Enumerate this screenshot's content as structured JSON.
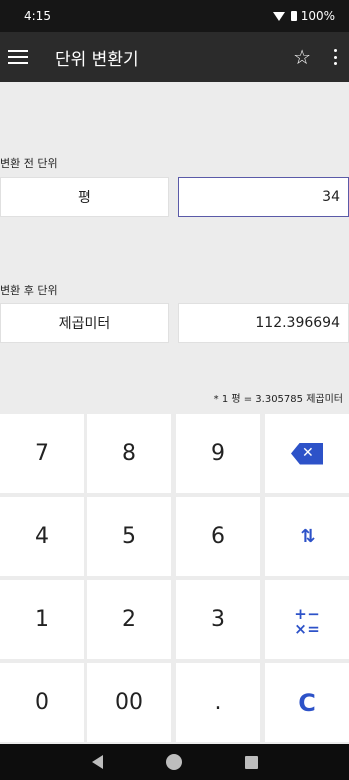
{
  "status_bar": {
    "time": "4:15",
    "battery": "100%"
  },
  "app_bar": {
    "title": "단위 변환기"
  },
  "from": {
    "label": "변환 전 단위",
    "unit": "평",
    "value": "34"
  },
  "to": {
    "label": "변환 후 단위",
    "unit": "제곱미터",
    "value": "112.396694"
  },
  "note": "* 1 평 = 3.305785 제곱미터",
  "keypad": {
    "k7": "7",
    "k8": "8",
    "k9": "9",
    "k4": "4",
    "k5": "5",
    "k6": "6",
    "k1": "1",
    "k2": "2",
    "k3": "3",
    "k0": "0",
    "k00": "00",
    "dot": ".",
    "clear": "C",
    "swap": "⇅",
    "ops": [
      "+",
      "−",
      "×",
      "="
    ]
  },
  "colors": {
    "accent": "#2d52c8",
    "app_bar": "#2b2b2b",
    "status_bar": "#161616",
    "background": "#ececec"
  },
  "icons": [
    "menu-icon",
    "star-icon",
    "more-vert-icon",
    "backspace-icon",
    "swap-icon",
    "operators-icon",
    "back-icon",
    "home-icon",
    "recents-icon"
  ]
}
